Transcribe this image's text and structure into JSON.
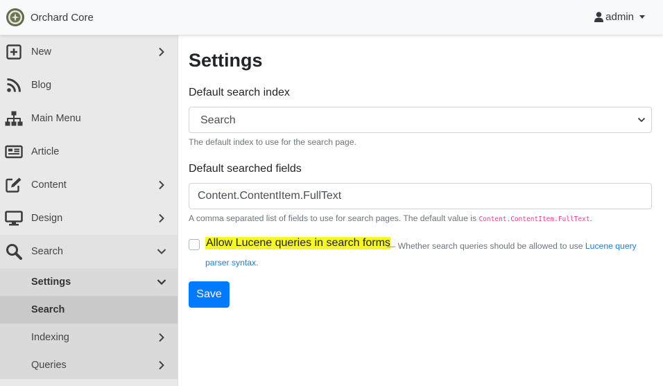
{
  "brand": {
    "name": "Orchard Core"
  },
  "user_menu": {
    "label": "admin"
  },
  "sidebar": {
    "items": [
      {
        "label": "New",
        "icon": "plus-square-icon",
        "chevron": "right"
      },
      {
        "label": "Blog",
        "icon": "rss-icon"
      },
      {
        "label": "Main Menu",
        "icon": "sitemap-icon"
      },
      {
        "label": "Article",
        "icon": "newspaper-icon"
      },
      {
        "label": "Content",
        "icon": "edit-icon",
        "chevron": "right"
      },
      {
        "label": "Design",
        "icon": "desktop-icon",
        "chevron": "right"
      },
      {
        "label": "Search",
        "icon": "search-icon",
        "chevron": "down"
      }
    ],
    "sub_items": [
      {
        "label": "Settings",
        "chevron": "down"
      },
      {
        "label": "Search"
      },
      {
        "label": "Indexing",
        "chevron": "right"
      },
      {
        "label": "Queries",
        "chevron": "right"
      }
    ]
  },
  "main": {
    "title": "Settings",
    "index_label": "Default search index",
    "index_value": "Search",
    "index_hint": "The default index to use for the search page.",
    "fields_label": "Default searched fields",
    "fields_value": "Content.ContentItem.FullText",
    "fields_hint": "A comma separated list of fields to use for search pages. The default value is",
    "fields_hint_code": "Content.ContentItem.FullText",
    "fields_hint_end": ".",
    "lucene_label": "Allow Lucene queries in search forms",
    "lucene_hint": "— Whether search queries should be allowed to use",
    "lucene_link_1": "Lucene query",
    "lucene_link_2": "parser syntax.",
    "save_label": "Save"
  },
  "colors": {
    "accent": "#007bff",
    "highlight": "#f7f722",
    "sidebar_bg": "#e9e9e9",
    "active_bg": "#c9c9c9"
  }
}
